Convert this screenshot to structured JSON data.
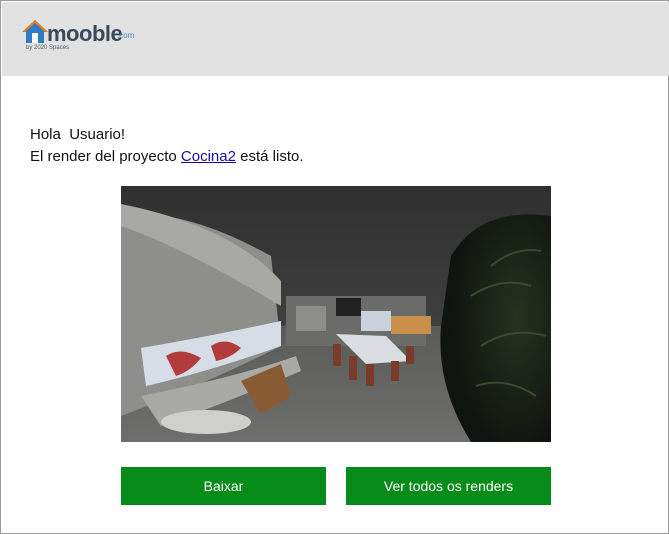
{
  "brand": {
    "name": "mooble",
    "tld": ".com",
    "tagline": "by 2020 Spaces",
    "color_house": "#2d7cc4",
    "color_roof": "#f07c20"
  },
  "message": {
    "greeting_prefix": "Hola",
    "user_name": "Usuario!",
    "line2_prefix": "El render del proyecto",
    "project_name": "Cocina2",
    "line2_suffix": "está listo."
  },
  "render_image": {
    "description_icon": "panorama-render-image"
  },
  "buttons": {
    "download_label": "Baixar",
    "view_all_label": "Ver todos os renders",
    "color": "#078c1a"
  }
}
